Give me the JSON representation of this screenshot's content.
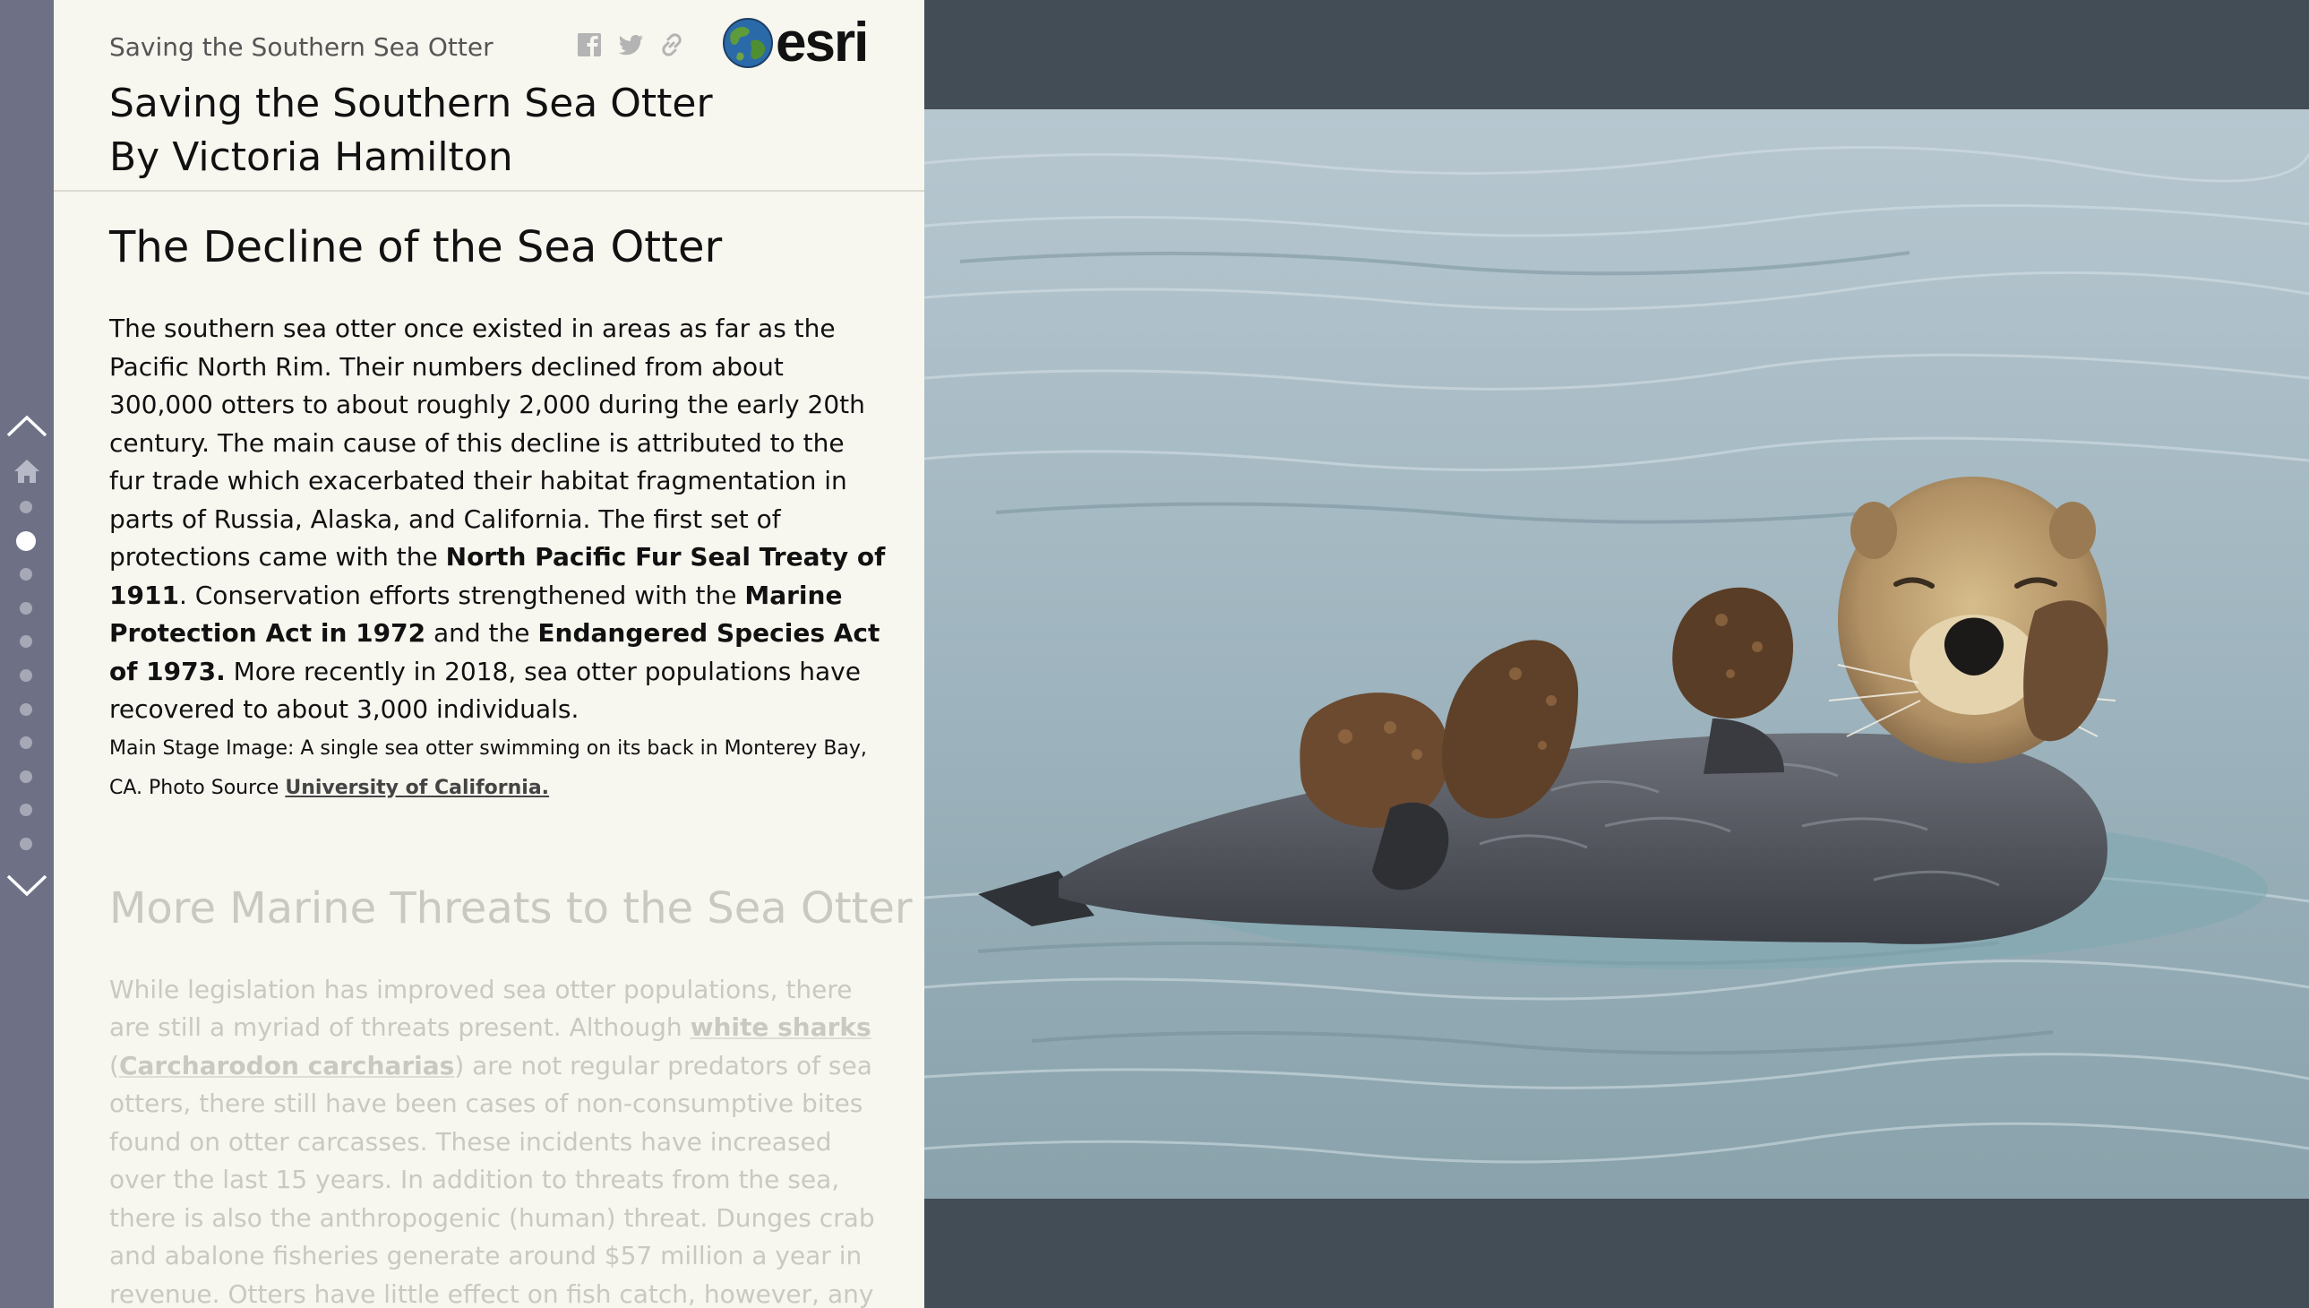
{
  "header": {
    "small_title": "Saving the Southern Sea Otter",
    "logo_text": "esri",
    "share_icons": [
      "facebook-icon",
      "twitter-icon",
      "link-icon"
    ]
  },
  "story": {
    "title_line1": "Saving the Southern Sea Otter",
    "title_line2": "By Victoria Hamilton"
  },
  "nav": {
    "dot_count": 11,
    "active_index": 1,
    "icons": [
      "chevron-up-icon",
      "home-icon",
      "chevron-down-icon"
    ]
  },
  "sections": [
    {
      "heading": "The Decline of the Sea Otter",
      "p_part1": "The southern sea otter once existed in areas as far as the Pacific North Rim. Their numbers declined from about 300,000 otters to about roughly 2,000 during the early 20th century. The main cause of this decline is attributed to the fur trade which exacerbated their habitat fragmentation in parts of Russia, Alaska, and California. The first set of protections came with the ",
      "bold1": "North Pacific Fur Seal Treaty of 1911",
      "p_part2": ". Conservation efforts strengthened with the ",
      "bold2": "Marine Protection Act in 1972",
      "p_part3": " and the ",
      "bold3": "Endangered Species Act of 1973.",
      "p_part4": " More recently in 2018, sea otter populations have recovered to about 3,000 individuals.",
      "caption": "Main Stage Image: A single sea otter swimming on its back in Monterey Bay, CA. Photo Source ",
      "caption_link": "University of California."
    },
    {
      "heading": "More Marine Threats to the Sea Otter",
      "p_part1": "While legislation has improved sea otter populations, there are still a myriad of threats present. Although ",
      "link1": "white sharks",
      "p_part2": " (",
      "link2": "Carcharodon carcharias",
      "p_part3": ") are not regular predators of sea otters, there still have been cases of non-consumptive bites found on otter carcasses. These incidents have increased over the last 15 years. In addition to threats from the sea, there is also the anthropogenic (human) threat. Dunges crab and abalone fisheries generate around $57 million a year in revenue. Otters have little effect on fish catch, however, any interference with"
    }
  ],
  "colors": {
    "panel_bg": "#f7f6ef",
    "nav_bg": "#6e7186",
    "stage_bg": "#434d55",
    "faded_text": "#c9c8c1"
  }
}
